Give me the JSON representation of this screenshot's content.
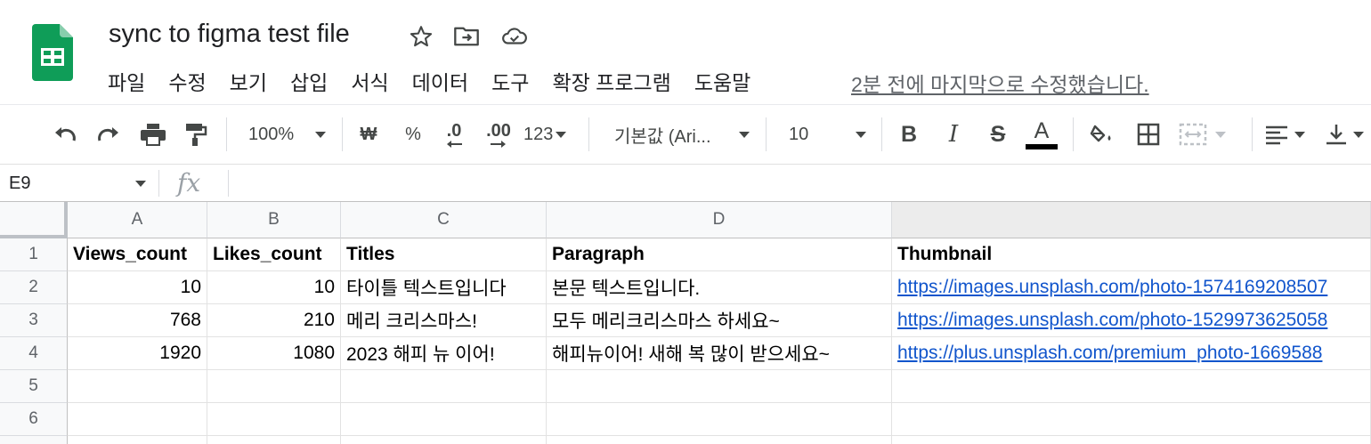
{
  "header": {
    "title": "sync to figma test file",
    "icons": [
      "star-icon",
      "move-to-folder-icon",
      "cloud-status-icon"
    ],
    "menu": [
      "파일",
      "수정",
      "보기",
      "삽입",
      "서식",
      "데이터",
      "도구",
      "확장 프로그램",
      "도움말"
    ],
    "last_edit": "2분 전에 마지막으로 수정했습니다."
  },
  "toolbar": {
    "zoom": "100%",
    "currency": "₩",
    "percent": "%",
    "decrease_decimal": ".0",
    "increase_decimal": ".00",
    "more_formats": "123",
    "font": "기본값 (Ari...",
    "font_size": "10",
    "bold": "B",
    "italic": "I",
    "strikethrough": "S",
    "text_color": "A",
    "colors": {
      "text_color_bar": "#000000",
      "brand_green": "#0f9d58"
    }
  },
  "formula_bar": {
    "name_box": "E9",
    "fx": "fx",
    "value": ""
  },
  "grid": {
    "columns": [
      "A",
      "B",
      "C",
      "D",
      ""
    ],
    "rows": [
      "1",
      "2",
      "3",
      "4",
      "5",
      "6"
    ],
    "cells": [
      [
        "Views_count",
        "Likes_count",
        "Titles",
        "Paragraph",
        "Thumbnail"
      ],
      [
        "10",
        "10",
        "타이틀 텍스트입니다",
        "본문 텍스트입니다.",
        "https://images.unsplash.com/photo-1574169208507"
      ],
      [
        "768",
        "210",
        "메리 크리스마스!",
        "모두 메리크리스마스 하세요~",
        "https://images.unsplash.com/photo-1529973625058"
      ],
      [
        "1920",
        "1080",
        "2023 해피 뉴 이어!",
        "해피뉴이어! 새해 복 많이 받으세요~",
        "https://plus.unsplash.com/premium_photo-1669588"
      ],
      [
        "",
        "",
        "",
        "",
        ""
      ],
      [
        "",
        "",
        "",
        "",
        ""
      ]
    ]
  }
}
